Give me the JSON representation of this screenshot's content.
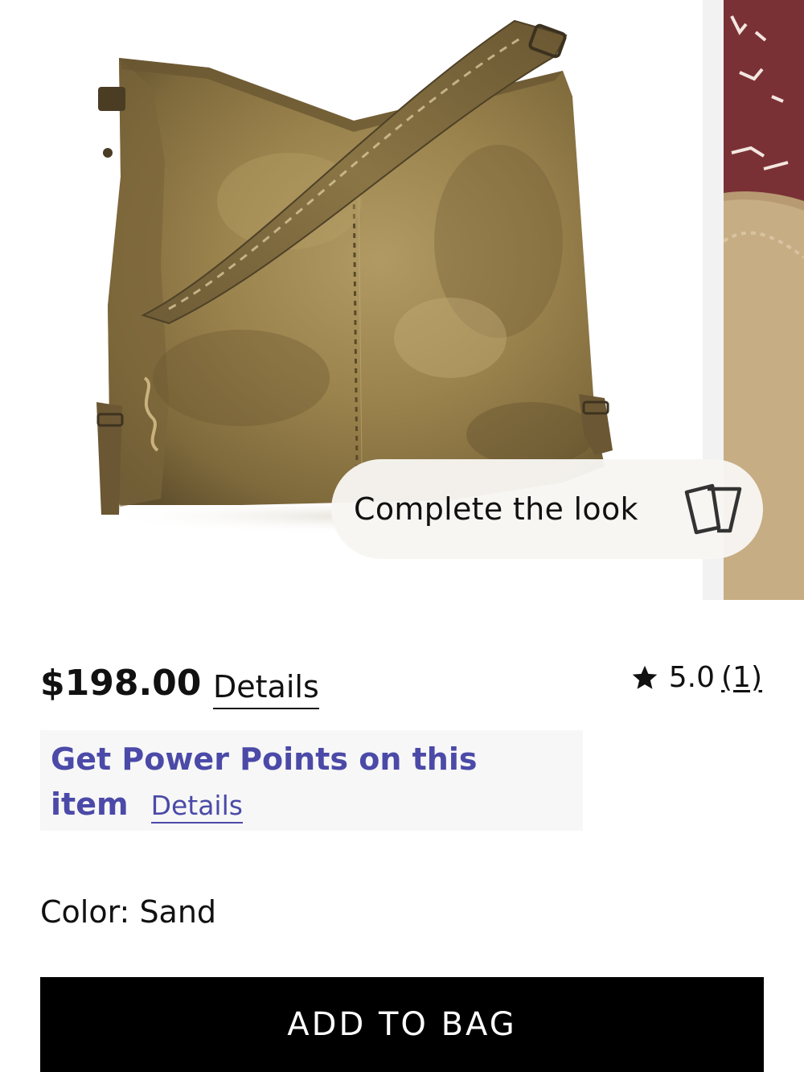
{
  "carousel": {
    "main_image": "suede hobo shoulder bag",
    "complete_look_label": "Complete the look",
    "complete_look_icon": "cards-icon"
  },
  "product": {
    "price": "$198.00",
    "price_details_link": "Details",
    "rating_icon": "star-icon",
    "rating_value": "5.0",
    "rating_count": "(1)"
  },
  "power_points": {
    "line1": "Get Power Points on this",
    "line2": "item",
    "details_link": "Details",
    "color": "#4b4aa8"
  },
  "color": {
    "label": "Color: ",
    "value": "Sand"
  },
  "actions": {
    "add_to_bag_label": "ADD TO BAG"
  }
}
